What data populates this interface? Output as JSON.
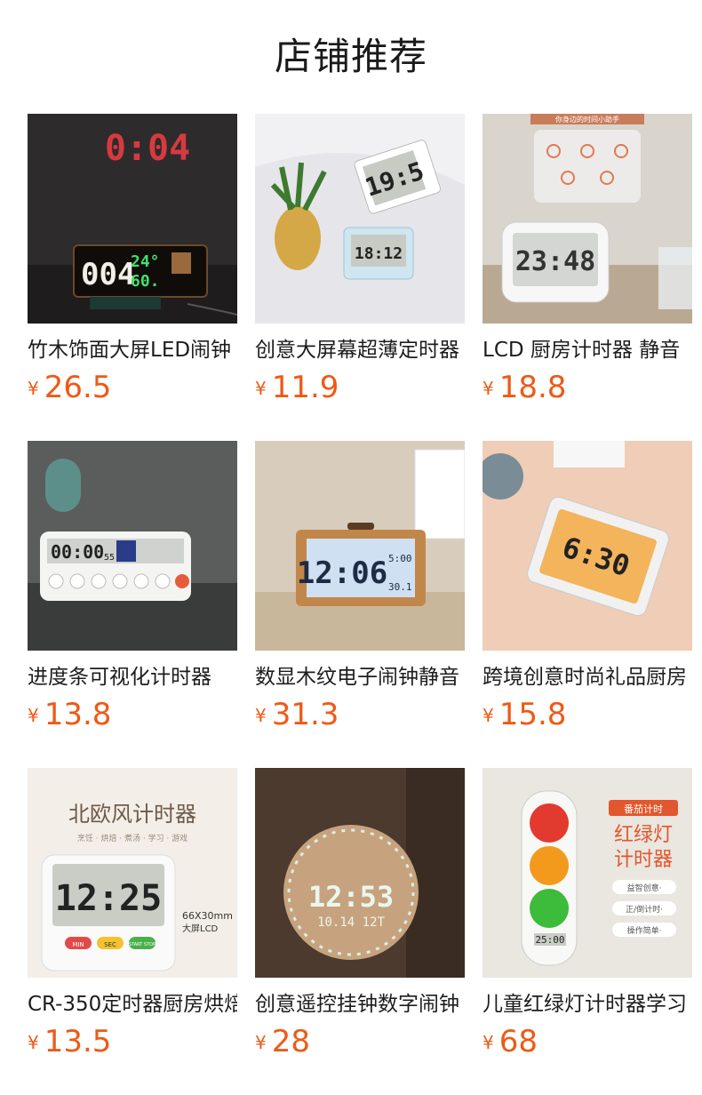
{
  "header": {
    "title": "店铺推荐"
  },
  "currency": "¥",
  "products": [
    {
      "name": "竹木饰面大屏LED闹钟",
      "price": "26.5"
    },
    {
      "name": "创意大屏幕超薄定时器",
      "price": "11.9"
    },
    {
      "name": "LCD 厨房计时器 静音",
      "price": "18.8"
    },
    {
      "name": "进度条可视化计时器",
      "price": "13.8"
    },
    {
      "name": "数显木纹电子闹钟静音",
      "price": "31.3"
    },
    {
      "name": "跨境创意时尚礼品厨房",
      "price": "15.8"
    },
    {
      "name": "CR-350定时器厨房烘焙",
      "price": "13.5"
    },
    {
      "name": "创意遥控挂钟数字闹钟",
      "price": "28"
    },
    {
      "name": "儿童红绿灯计时器学习",
      "price": "68"
    }
  ],
  "image_text": {
    "p1_projection": "0:04",
    "p1_display_main": "004",
    "p1_display_top": "24°",
    "p1_display_bottom": "60.",
    "p2_big": "19:5",
    "p2_small": "18:12",
    "p3_banner": "你身边的时间小助手",
    "p3_display": "23:48",
    "p4_display": "00:00",
    "p4_display_sub": "55",
    "p5_display": "12:06",
    "p5_side_top": "5:00",
    "p5_side_bottom": "30.1",
    "p6_display": "6:30",
    "p7_banner": "北欧风计时器",
    "p7_sub": "烹饪 · 烘焙 · 煮汤 · 学习 · 游戏",
    "p7_display": "12:25",
    "p7_size": "66X30mm",
    "p7_screen": "大屏LCD",
    "p7_btn_min": "MIN",
    "p7_btn_sec": "SEC",
    "p7_btn_start": "START STOP",
    "p8_display": "12:53",
    "p8_sub": "10.14 12T",
    "p9_tag": "番茄计时",
    "p9_title1": "红绿灯",
    "p9_title2": "计时器",
    "p9_f1": "益智创意·",
    "p9_f2": "正/倒计时·",
    "p9_f3": "操作简单·",
    "p9_display": "25:00"
  },
  "colors": {
    "price": "#ee5a16",
    "title": "#1a1a1a",
    "text": "#1d1d1d"
  }
}
